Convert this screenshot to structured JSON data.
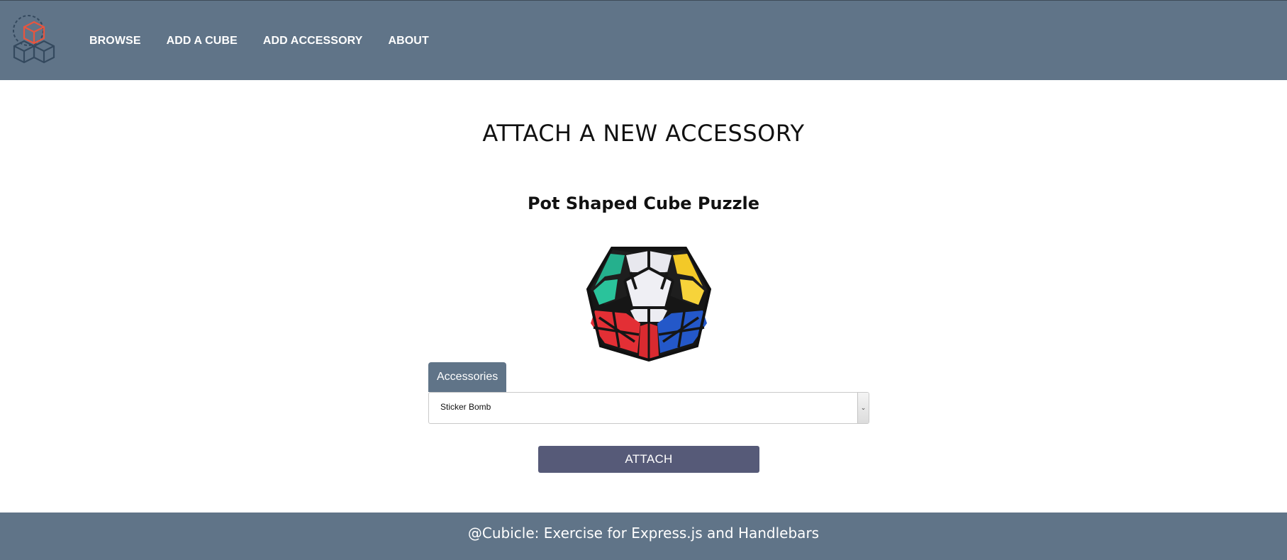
{
  "header": {
    "logo_icon": "cubes-logo-icon",
    "nav": [
      {
        "label": "BROWSE"
      },
      {
        "label": "ADD A CUBE"
      },
      {
        "label": "ADD ACCESSORY"
      },
      {
        "label": "ABOUT"
      }
    ]
  },
  "main": {
    "title": "ATTACH A NEW ACCESSORY",
    "cube_name": "Pot Shaped Cube Puzzle",
    "cube_image_icon": "megaminx-cube-image",
    "form": {
      "select_label": "Accessories",
      "selected_option": "Sticker Bomb",
      "arrow_icon": "chevron-down-icon",
      "submit_label": "ATTACH"
    }
  },
  "footer": {
    "text": "@Cubicle: Exercise for Express.js and Handlebars"
  },
  "colors": {
    "header_bg": "#607488",
    "footer_bg": "#607488",
    "button_bg": "#565a78",
    "logo_accent": "#e8553e",
    "logo_outline": "#34495e"
  }
}
